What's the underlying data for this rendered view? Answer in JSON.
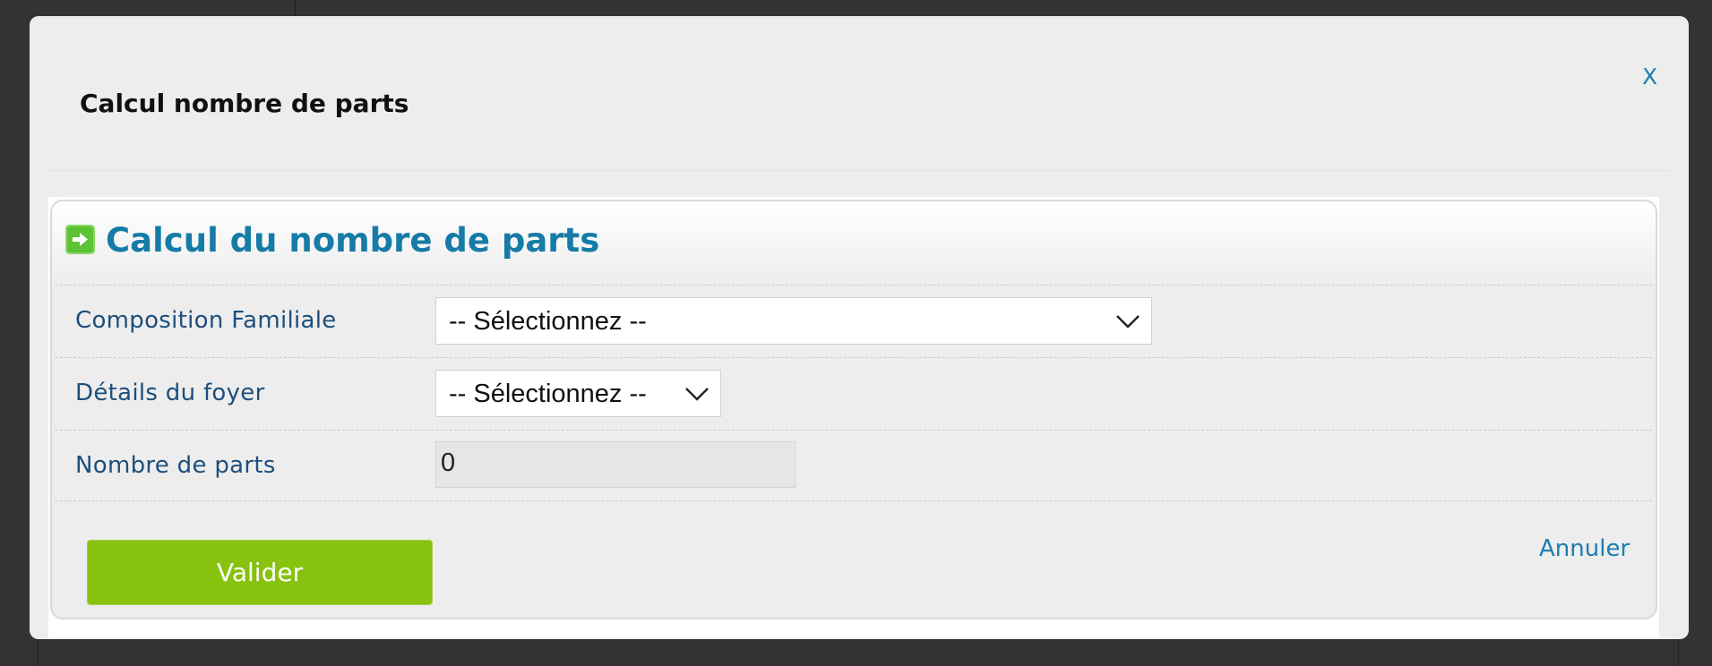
{
  "modal": {
    "title": "Calcul nombre de parts",
    "close_label": "X"
  },
  "panel": {
    "title": "Calcul du nombre de parts",
    "icon": "arrow-right-icon",
    "icon_color": "#5cc332"
  },
  "form": {
    "composition": {
      "label": "Composition Familiale",
      "selected": "-- Sélectionnez --"
    },
    "details": {
      "label": "Détails du foyer",
      "selected": "-- Sélectionnez --"
    },
    "parts": {
      "label": "Nombre de parts",
      "value": "0"
    }
  },
  "actions": {
    "submit_label": "Valider",
    "cancel_label": "Annuler",
    "submit_color": "#87c20e"
  },
  "colors": {
    "accent": "#167ba7",
    "link": "#1a7fb0",
    "label": "#1d4f7c",
    "overlay": "#333333"
  }
}
